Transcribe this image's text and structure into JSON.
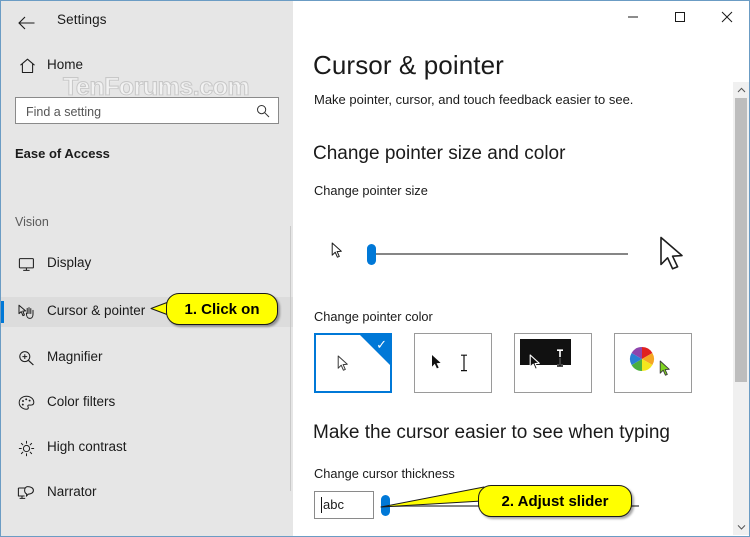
{
  "window": {
    "app_title": "Settings",
    "back_icon": "back-arrow-icon",
    "controls": {
      "minimize": "minimize-icon",
      "maximize": "maximize-icon",
      "close": "close-icon"
    }
  },
  "watermark": {
    "text": "TenForums.com"
  },
  "sidebar": {
    "home": {
      "label": "Home",
      "icon": "home-icon"
    },
    "search": {
      "placeholder": "Find a setting",
      "value": "",
      "icon": "search-icon"
    },
    "group_heading": "Ease of Access",
    "section_heading": "Vision",
    "items": [
      {
        "label": "Display",
        "icon": "monitor-icon",
        "selected": false
      },
      {
        "label": "Cursor & pointer",
        "icon": "cursor-hand-icon",
        "selected": true
      },
      {
        "label": "Magnifier",
        "icon": "magnifier-icon",
        "selected": false
      },
      {
        "label": "Color filters",
        "icon": "palette-icon",
        "selected": false
      },
      {
        "label": "High contrast",
        "icon": "brightness-sun-icon",
        "selected": false
      },
      {
        "label": "Narrator",
        "icon": "narrator-speech-icon",
        "selected": false
      }
    ]
  },
  "main": {
    "title": "Cursor & pointer",
    "subtitle": "Make pointer, cursor, and touch feedback easier to see.",
    "section_pointer": {
      "heading": "Change pointer size and color",
      "size_label": "Change pointer size",
      "slider": {
        "value": 1,
        "min": 1,
        "max": 15
      },
      "preview_small_icon": "small-pointer-preview-icon",
      "preview_large_icon": "large-pointer-preview-icon",
      "color_label": "Change pointer color",
      "color_options": [
        {
          "name": "white-pointer-option",
          "selected": true
        },
        {
          "name": "black-pointer-option",
          "selected": false
        },
        {
          "name": "inverted-pointer-option",
          "selected": false
        },
        {
          "name": "custom-color-pointer-option",
          "selected": false
        }
      ],
      "selected_check_icon": "check-icon"
    },
    "section_cursor": {
      "heading": "Make the cursor easier to see when typing",
      "thickness_label": "Change cursor thickness",
      "preview_text": "abc",
      "slider": {
        "value": 1,
        "min": 1,
        "max": 20
      }
    },
    "scrollbar": {
      "up_icon": "chevron-up-icon",
      "down_icon": "chevron-down-icon"
    }
  },
  "callouts": [
    {
      "text": "1. Click on"
    },
    {
      "text": "2. Adjust slider"
    }
  ],
  "colors": {
    "accent": "#0078d7",
    "sidebar_bg": "#e6e6e6",
    "callout_bg": "#ffff00",
    "window_border": "#6b9cc4"
  }
}
